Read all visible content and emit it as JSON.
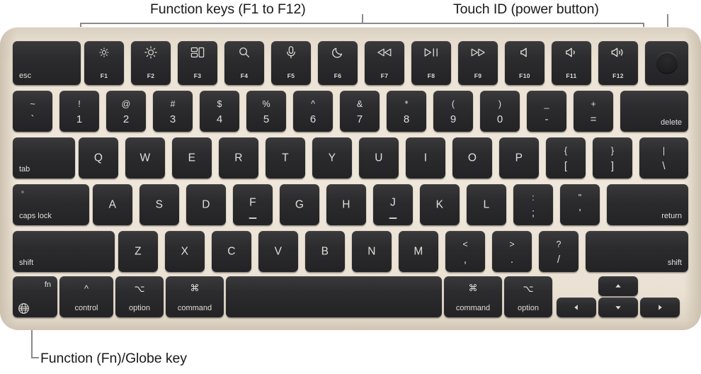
{
  "annotations": {
    "function_keys": "Function keys (F1 to F12)",
    "touch_id": "Touch ID (power button)",
    "fn_globe": "Function (Fn)/Globe key"
  },
  "colors": {
    "chassis": "#efe7da",
    "key": "#2c2c2e",
    "legend": "#e0ddd8",
    "leader_line": "#8a8a8a",
    "text": "#1a1a1a"
  },
  "keyboard": {
    "layout": "US English",
    "rows": [
      {
        "name": "function-row",
        "keys": [
          {
            "id": "esc",
            "label": "esc",
            "align": "bottom-left"
          },
          {
            "id": "f1",
            "fkey": "F1",
            "icon": "brightness-down-icon"
          },
          {
            "id": "f2",
            "fkey": "F2",
            "icon": "brightness-up-icon"
          },
          {
            "id": "f3",
            "fkey": "F3",
            "icon": "mission-control-icon"
          },
          {
            "id": "f4",
            "fkey": "F4",
            "icon": "spotlight-search-icon"
          },
          {
            "id": "f5",
            "fkey": "F5",
            "icon": "dictation-microphone-icon"
          },
          {
            "id": "f6",
            "fkey": "F6",
            "icon": "do-not-disturb-moon-icon"
          },
          {
            "id": "f7",
            "fkey": "F7",
            "icon": "rewind-icon"
          },
          {
            "id": "f8",
            "fkey": "F8",
            "icon": "play-pause-icon"
          },
          {
            "id": "f9",
            "fkey": "F9",
            "icon": "fast-forward-icon"
          },
          {
            "id": "f10",
            "fkey": "F10",
            "icon": "volume-mute-icon"
          },
          {
            "id": "f11",
            "fkey": "F11",
            "icon": "volume-down-icon"
          },
          {
            "id": "f12",
            "fkey": "F12",
            "icon": "volume-up-icon"
          },
          {
            "id": "touchid",
            "icon": "touch-id-icon"
          }
        ]
      },
      {
        "name": "number-row",
        "keys": [
          {
            "id": "grave",
            "top": "~",
            "bottom": "`"
          },
          {
            "id": "1",
            "top": "!",
            "bottom": "1"
          },
          {
            "id": "2",
            "top": "@",
            "bottom": "2"
          },
          {
            "id": "3",
            "top": "#",
            "bottom": "3"
          },
          {
            "id": "4",
            "top": "$",
            "bottom": "4"
          },
          {
            "id": "5",
            "top": "%",
            "bottom": "5"
          },
          {
            "id": "6",
            "top": "^",
            "bottom": "6"
          },
          {
            "id": "7",
            "top": "&",
            "bottom": "7"
          },
          {
            "id": "8",
            "top": "*",
            "bottom": "8"
          },
          {
            "id": "9",
            "top": "(",
            "bottom": "9"
          },
          {
            "id": "0",
            "top": ")",
            "bottom": "0"
          },
          {
            "id": "minus",
            "top": "_",
            "bottom": "-"
          },
          {
            "id": "equal",
            "top": "+",
            "bottom": "="
          },
          {
            "id": "delete",
            "label": "delete",
            "align": "bottom-right"
          }
        ]
      },
      {
        "name": "top-letter-row",
        "keys": [
          {
            "id": "tab",
            "label": "tab",
            "align": "bottom-left"
          },
          {
            "id": "q",
            "label": "Q"
          },
          {
            "id": "w",
            "label": "W"
          },
          {
            "id": "e",
            "label": "E"
          },
          {
            "id": "r",
            "label": "R"
          },
          {
            "id": "t",
            "label": "T"
          },
          {
            "id": "y",
            "label": "Y"
          },
          {
            "id": "u",
            "label": "U"
          },
          {
            "id": "i",
            "label": "I"
          },
          {
            "id": "o",
            "label": "O"
          },
          {
            "id": "p",
            "label": "P"
          },
          {
            "id": "lbracket",
            "top": "{",
            "bottom": "["
          },
          {
            "id": "rbracket",
            "top": "}",
            "bottom": "]"
          },
          {
            "id": "backslash",
            "top": "|",
            "bottom": "\\"
          }
        ]
      },
      {
        "name": "home-row",
        "keys": [
          {
            "id": "capslock",
            "label": "caps lock",
            "align": "bottom-left",
            "led": true
          },
          {
            "id": "a",
            "label": "A"
          },
          {
            "id": "s",
            "label": "S"
          },
          {
            "id": "d",
            "label": "D"
          },
          {
            "id": "f",
            "label": "F",
            "homing": true
          },
          {
            "id": "g",
            "label": "G"
          },
          {
            "id": "h",
            "label": "H"
          },
          {
            "id": "j",
            "label": "J",
            "homing": true
          },
          {
            "id": "k",
            "label": "K"
          },
          {
            "id": "l",
            "label": "L"
          },
          {
            "id": "semicolon",
            "top": ":",
            "bottom": ";"
          },
          {
            "id": "quote",
            "top": "\"",
            "bottom": "'"
          },
          {
            "id": "return",
            "label": "return",
            "align": "bottom-right"
          }
        ]
      },
      {
        "name": "shift-row",
        "keys": [
          {
            "id": "lshift",
            "label": "shift",
            "align": "bottom-left"
          },
          {
            "id": "z",
            "label": "Z"
          },
          {
            "id": "x",
            "label": "X"
          },
          {
            "id": "c",
            "label": "C"
          },
          {
            "id": "v",
            "label": "V"
          },
          {
            "id": "b",
            "label": "B"
          },
          {
            "id": "n",
            "label": "N"
          },
          {
            "id": "m",
            "label": "M"
          },
          {
            "id": "comma",
            "top": "<",
            "bottom": ","
          },
          {
            "id": "period",
            "top": ">",
            "bottom": "."
          },
          {
            "id": "slash",
            "top": "?",
            "bottom": "/"
          },
          {
            "id": "rshift",
            "label": "shift",
            "align": "bottom-right"
          }
        ]
      },
      {
        "name": "bottom-row",
        "keys": [
          {
            "id": "fn",
            "label": "fn",
            "align": "top-right",
            "icon": "globe-icon"
          },
          {
            "id": "lcontrol",
            "label": "control",
            "symbol": "^"
          },
          {
            "id": "loption",
            "label": "option",
            "symbol": "⌥"
          },
          {
            "id": "lcommand",
            "label": "command",
            "symbol": "⌘"
          },
          {
            "id": "space",
            "label": ""
          },
          {
            "id": "rcommand",
            "label": "command",
            "symbol": "⌘"
          },
          {
            "id": "roption",
            "label": "option",
            "symbol": "⌥"
          },
          {
            "id": "left",
            "icon": "arrow-left-icon"
          },
          {
            "id": "up",
            "icon": "arrow-up-icon"
          },
          {
            "id": "down",
            "icon": "arrow-down-icon"
          },
          {
            "id": "right",
            "icon": "arrow-right-icon"
          }
        ]
      }
    ]
  }
}
